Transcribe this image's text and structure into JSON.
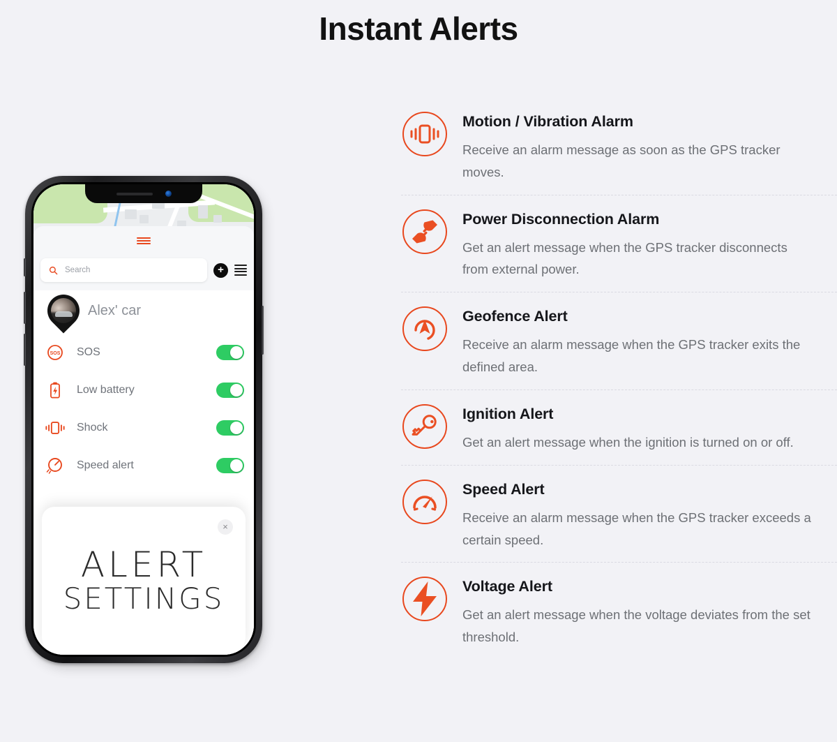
{
  "page": {
    "title": "Instant Alerts",
    "accent_color": "#e8481e",
    "background_color": "#f2f2f6",
    "toggle_on_color": "#2ecc63"
  },
  "phone": {
    "grabber_icon": "drag-handle-icon",
    "search": {
      "icon": "search-icon",
      "placeholder": "Search",
      "value": ""
    },
    "add_button_label": "+",
    "menu_icon": "hamburger-menu-icon",
    "device": {
      "avatar_icon": "map-pin-avatar",
      "name": "Alex' car"
    },
    "alert_rows": [
      {
        "icon": "sos-icon",
        "label": "SOS",
        "toggle": "on"
      },
      {
        "icon": "low-battery-icon",
        "label": "Low battery",
        "toggle": "on"
      },
      {
        "icon": "shock-icon",
        "label": "Shock",
        "toggle": "on"
      },
      {
        "icon": "speedometer-icon",
        "label": "Speed alert",
        "toggle": "on"
      }
    ],
    "card": {
      "close_label": "×",
      "title_line1": "ALERT",
      "title_line2": "SETTINGS"
    }
  },
  "features": [
    {
      "icon": "vibration-icon",
      "title": "Motion / Vibration Alarm",
      "description": "Receive an alarm message as soon as the GPS tracker moves."
    },
    {
      "icon": "power-plug-disconnected-icon",
      "title": "Power Disconnection Alarm",
      "description": "Get an alert message when the GPS tracker disconnects from external power."
    },
    {
      "icon": "geofence-navigation-icon",
      "title": "Geofence Alert",
      "description": "Receive an alarm message when the GPS tracker exits the defined area."
    },
    {
      "icon": "key-ignition-icon",
      "title": "Ignition Alert",
      "description": "Get an alert message when the ignition is turned on or off."
    },
    {
      "icon": "speedometer-icon",
      "title": "Speed Alert",
      "description": "Receive an alarm message when the GPS tracker exceeds a certain speed."
    },
    {
      "icon": "lightning-bolt-icon",
      "title": "Voltage Alert",
      "description": "Get an alert message when the voltage deviates from the set threshold."
    }
  ]
}
